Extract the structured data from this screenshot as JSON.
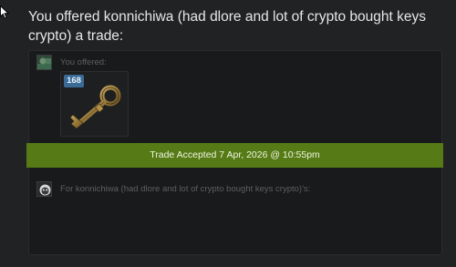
{
  "headline": "You offered konnichiwa (had dlore and lot of crypto bought keys crypto) a trade:",
  "trade": {
    "you_offered_label": "You offered:",
    "item": {
      "quantity": "168",
      "icon": "key-icon"
    },
    "status_text": "Trade Accepted 7 Apr, 2026 @ 10:55pm",
    "for_partner_label": "For konnichiwa (had dlore and lot of crypto bought keys crypto)'s:"
  },
  "colors": {
    "background": "#202224",
    "panel": "#181a1b",
    "accepted_bar": "#567a15",
    "badge": "#3a6b97"
  }
}
